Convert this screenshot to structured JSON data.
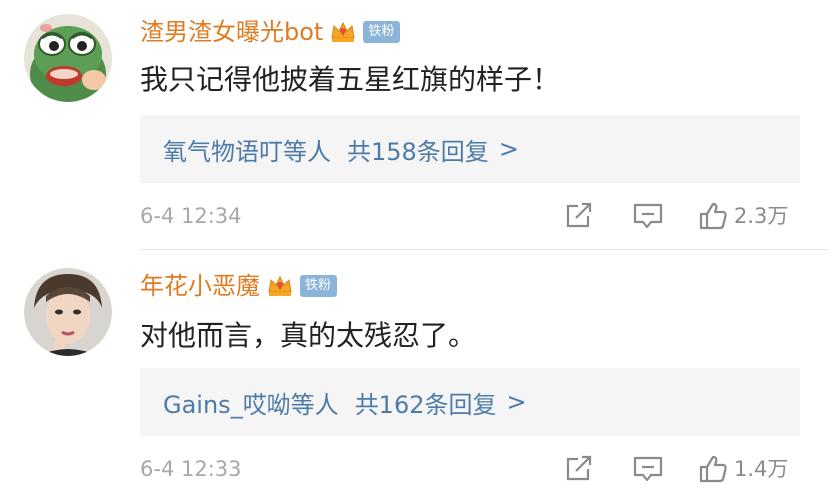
{
  "comments": [
    {
      "username": "渣男渣女曝光bot",
      "badge": "铁粉",
      "text": "我只记得他披着五星红旗的样子！",
      "reply_users": "氧气物语叮等人",
      "reply_count": "共158条回复",
      "reply_chevron": ">",
      "time": "6-4 12:34",
      "likes": "2.3万",
      "avatar_icon": "frog-avatar"
    },
    {
      "username": "年花小恶魔",
      "badge": "铁粉",
      "text": "对他而言，真的太残忍了。",
      "reply_users": "Gains_哎呦等人",
      "reply_count": "共162条回复",
      "reply_chevron": ">",
      "time": "6-4 12:33",
      "likes": "1.4万",
      "avatar_icon": "portrait-avatar"
    }
  ],
  "colors": {
    "username": "#e07b22",
    "link": "#4d7ba8",
    "badge_bg": "#8ab4d8",
    "meta": "#a8a8a8"
  }
}
